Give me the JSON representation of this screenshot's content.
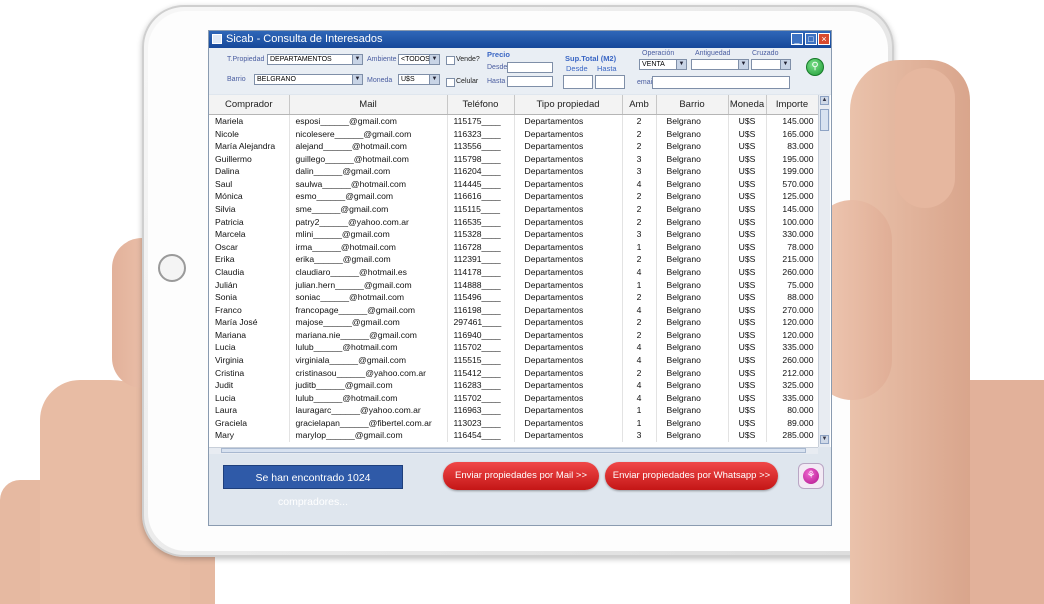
{
  "window": {
    "title": "Sicab - Consulta de Interesados",
    "min": "_",
    "max": "□",
    "close": "×"
  },
  "filters": {
    "tipo_propiedad_label": "T.Propiedad",
    "tipo_propiedad_value": "DEPARTAMENTOS",
    "ambiente_label": "Ambiente",
    "ambiente_value": "<TODOS>",
    "vende_label": "Vende?",
    "barrio_label": "Barrio",
    "barrio_value": "BELGRANO",
    "moneda_label": "Moneda",
    "moneda_value": "U$S",
    "celular_label": "Celular",
    "precio_label": "Precio",
    "desde_label": "Desde",
    "hasta_label": "Hasta",
    "sup_total_label": "Sup.Total (M2)",
    "sup_desde_label": "Desde",
    "sup_hasta_label": "Hasta",
    "operacion_label": "Operación",
    "operacion_value": "VENTA",
    "antiguedad_label": "Antiguedad",
    "cruzado_label": "Cruzado",
    "email_label": "email"
  },
  "grid": {
    "columns": [
      "Comprador",
      "Mail",
      "Teléfono",
      "Tipo propiedad",
      "Amb",
      "Barrio",
      "Moneda",
      "Importe"
    ],
    "rows": [
      [
        "Mariela",
        "esposi______@gmail.com",
        "115175____",
        "Departamentos",
        "2",
        "Belgrano",
        "U$S",
        "145.000"
      ],
      [
        "Nicole",
        "nicolesere______@gmail.com",
        "116323____",
        "Departamentos",
        "2",
        "Belgrano",
        "U$S",
        "165.000"
      ],
      [
        "María Alejandra",
        "alejand______@hotmail.com",
        "113556____",
        "Departamentos",
        "2",
        "Belgrano",
        "U$S",
        "83.000"
      ],
      [
        "Guillermo",
        "guillego______@hotmail.com",
        "115798____",
        "Departamentos",
        "3",
        "Belgrano",
        "U$S",
        "195.000"
      ],
      [
        "Dalina",
        "dalin______@gmail.com",
        "116204____",
        "Departamentos",
        "3",
        "Belgrano",
        "U$S",
        "199.000"
      ],
      [
        "Saul",
        "saulwa______@hotmail.com",
        "114445____",
        "Departamentos",
        "4",
        "Belgrano",
        "U$S",
        "570.000"
      ],
      [
        "Mónica",
        "esmo______@gmail.com",
        "116616____",
        "Departamentos",
        "2",
        "Belgrano",
        "U$S",
        "125.000"
      ],
      [
        "Silvia",
        "sme______@gmail.com",
        "115115____",
        "Departamentos",
        "2",
        "Belgrano",
        "U$S",
        "145.000"
      ],
      [
        "Patricia",
        "patry2______@yahoo.com.ar",
        "116535____",
        "Departamentos",
        "2",
        "Belgrano",
        "U$S",
        "100.000"
      ],
      [
        "Marcela",
        "mlini______@gmail.com",
        "115328____",
        "Departamentos",
        "3",
        "Belgrano",
        "U$S",
        "330.000"
      ],
      [
        "Oscar",
        "irma______@hotmail.com",
        "116728____",
        "Departamentos",
        "1",
        "Belgrano",
        "U$S",
        "78.000"
      ],
      [
        "Erika",
        "erika______@gmail.com",
        "112391____",
        "Departamentos",
        "2",
        "Belgrano",
        "U$S",
        "215.000"
      ],
      [
        "Claudia",
        "claudiaro______@hotmail.es",
        "114178____",
        "Departamentos",
        "4",
        "Belgrano",
        "U$S",
        "260.000"
      ],
      [
        "Julián",
        "julian.hern______@gmail.com",
        "114888____",
        "Departamentos",
        "1",
        "Belgrano",
        "U$S",
        "75.000"
      ],
      [
        "Sonia",
        "soniac______@hotmail.com",
        "115496____",
        "Departamentos",
        "2",
        "Belgrano",
        "U$S",
        "88.000"
      ],
      [
        "Franco",
        "francopage______@gmail.com",
        "116198____",
        "Departamentos",
        "4",
        "Belgrano",
        "U$S",
        "270.000"
      ],
      [
        "María José",
        "majose______@gmail.com",
        "297461____",
        "Departamentos",
        "2",
        "Belgrano",
        "U$S",
        "120.000"
      ],
      [
        "Mariana",
        "mariana.nie______@gmail.com",
        "116940____",
        "Departamentos",
        "2",
        "Belgrano",
        "U$S",
        "120.000"
      ],
      [
        "Lucia",
        "lulub______@hotmail.com",
        "115702____",
        "Departamentos",
        "4",
        "Belgrano",
        "U$S",
        "335.000"
      ],
      [
        "Virginia",
        "virginiala______@gmail.com",
        "115515____",
        "Departamentos",
        "4",
        "Belgrano",
        "U$S",
        "260.000"
      ],
      [
        "Cristina",
        "cristinasou______@yahoo.com.ar",
        "115412____",
        "Departamentos",
        "2",
        "Belgrano",
        "U$S",
        "212.000"
      ],
      [
        "Judit",
        "juditb______@gmail.com",
        "116283____",
        "Departamentos",
        "4",
        "Belgrano",
        "U$S",
        "325.000"
      ],
      [
        "Lucia",
        "lulub______@hotmail.com",
        "115702____",
        "Departamentos",
        "4",
        "Belgrano",
        "U$S",
        "335.000"
      ],
      [
        "Laura",
        "lauragarc______@yahoo.com.ar",
        "116963____",
        "Departamentos",
        "1",
        "Belgrano",
        "U$S",
        "80.000"
      ],
      [
        "Graciela",
        "gracielapan______@fibertel.com.ar",
        "113023____",
        "Departamentos",
        "1",
        "Belgrano",
        "U$S",
        "89.000"
      ],
      [
        "Mary",
        "marylop______@gmail.com",
        "116454____",
        "Departamentos",
        "3",
        "Belgrano",
        "U$S",
        "285.000"
      ]
    ]
  },
  "footer": {
    "status_text": "Se han encontrado 1024 compradores...",
    "mail_button": "Enviar propiedades por Mail >>",
    "whatsapp_button": "Enviar propiedades por Whatsapp >>"
  },
  "icons": {
    "search": "search-icon",
    "exit": "exit-icon",
    "home": "home-button"
  },
  "colors": {
    "titlebar": "#1f56a8",
    "status_bg": "#2f5aa8",
    "action_buttons": "#d62222",
    "search_button": "#1d9a34"
  }
}
